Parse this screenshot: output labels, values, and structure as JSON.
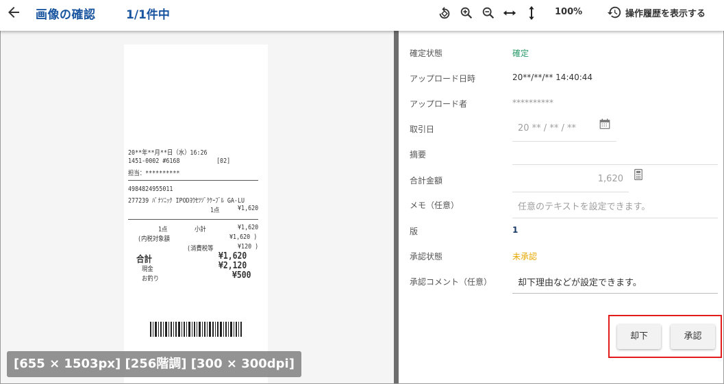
{
  "header": {
    "title": "画像の確認",
    "pager": "1/1件中",
    "zoom": "100%",
    "history_label": "操作履歴を表示する"
  },
  "viewer": {
    "image_info": "[655 × 1503px] [256階調] [300 × 300dpi]",
    "receipt": {
      "datetime": "20**年**月**日（水）16:26",
      "store": "1451-0002 #6168",
      "reg": "[02]",
      "staff": "担当：**********",
      "jan": "4984824955011",
      "item": "277239 ﾊﾟﾅｿﾆｯｸ IPODﾖｳｾﾂｿﾞｸｹｰﾌﾞﾙ GA-LU",
      "item_qty": "1点",
      "item_price": "¥1,620",
      "count": "1点",
      "subtotal_label": "小計",
      "subtotal": "¥1,620",
      "tax_target_label": "(内税対象額",
      "tax_target": "¥1,620 )",
      "tax_label": "(消費税等",
      "tax": "¥120 )",
      "total_label": "合計",
      "total": "¥1,620",
      "cash_label": "現金",
      "cash": "¥2,120",
      "change_label": "お釣り",
      "change": "¥500"
    }
  },
  "form": {
    "status_label": "確定状態",
    "status_value": "確定",
    "uploaded_at_label": "アップロード日時",
    "uploaded_at_value": "20**/**/** 14:40:44",
    "uploader_label": "アップロード者",
    "uploader_value": "**********",
    "trade_date_label": "取引日",
    "trade_date_value": "20 ** / ** / **",
    "summary_label": "摘要",
    "summary_value": "",
    "total_label": "合計金額",
    "total_value": "1,620",
    "memo_label": "メモ（任意）",
    "memo_placeholder": "任意のテキストを設定できます。",
    "version_label": "版",
    "version_value": "1",
    "approval_label": "承認状態",
    "approval_value": "未承認",
    "comment_label": "承認コメント（任意）",
    "comment_placeholder": "却下理由などが設定できます。",
    "reject_label": "却下",
    "approve_label": "承認"
  },
  "colors": {
    "title": "#1a56a0",
    "confirmed": "#2a9a6a",
    "pending": "#e6a700",
    "highlight_border": "#e21b1b"
  }
}
